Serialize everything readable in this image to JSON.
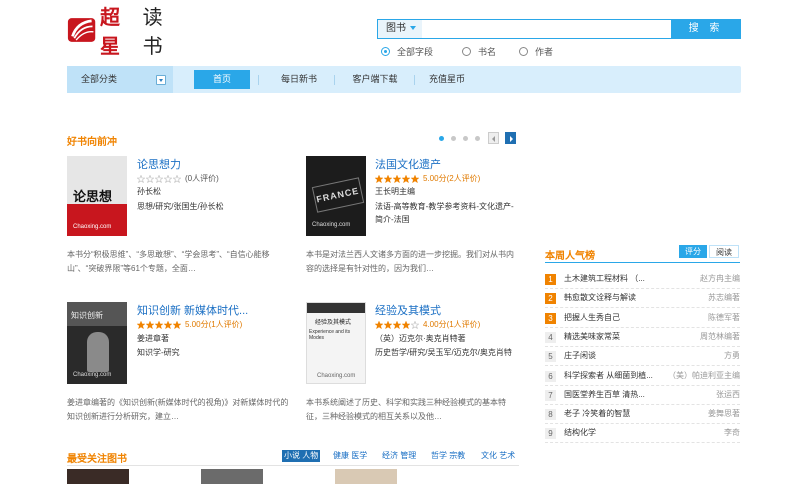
{
  "header": {
    "logo_text": "超星",
    "site_name": "读书",
    "search": {
      "category": "图书",
      "placeholder": "",
      "button": "搜 索",
      "options": [
        "全部字段",
        "书名",
        "作者"
      ]
    }
  },
  "nav": {
    "all_categories": "全部分类",
    "items": [
      "首页",
      "每日新书",
      "客户端下载",
      "充值星币"
    ]
  },
  "featured": {
    "title": "好书向前冲",
    "books": [
      {
        "title": "论思想力",
        "rating_text": "(0人评价)",
        "stars": 0,
        "author": "孙长松",
        "tags": "思想/研究/张国生/孙长松",
        "description": "本书分“积极思维”、“多思敢想”、“学会思考”、“自信心能移山”、“突破界限”等61个专题，全面…",
        "cover_title": "论思想力",
        "watermark": "Chaoxing.com"
      },
      {
        "title": "法国文化遗产",
        "rating_text": "5.00分(2人评价)",
        "stars": 5,
        "author": "王长明主编",
        "tags": "法语-高等教育-教学参考资料-文化遗产-简介-法国",
        "description": "本书是对法兰西人文诸多方面的进一步挖掘。我们对从书内容的选择是有针对性的，因为我们…",
        "cover_title": "FRANCE",
        "watermark": "Chaoxing.com"
      },
      {
        "title": "知识创新 新媒体时代...",
        "rating_text": "5.00分(1人评价)",
        "stars": 5,
        "author": "姜进章著",
        "tags": "知识学-研究",
        "description": "姜进章编著的《知识创新(新媒体时代的视角)》对新媒体时代的知识创新进行分析研究，建立…",
        "cover_title": "知识创新",
        "watermark": "Chaoxing.com"
      },
      {
        "title": "经验及其模式",
        "rating_text": "4.00分(1人评价)",
        "stars": 4,
        "author": "（英）迈克尔·奥克肖特著",
        "tags": "历史哲学/研究/吴玉军/迈克尔/奥克肖特",
        "description": "本书系统阐述了历史、科学和实践三种经验模式的基本特征，三种经验模式的相互关系以及他…",
        "cover_title": "经验及其模式",
        "cover_sub": "Experience and its Modes",
        "watermark": "Chaoxing.com"
      }
    ]
  },
  "ranking": {
    "title": "本周人气榜",
    "tabs": [
      "评分",
      "阅读"
    ],
    "items": [
      {
        "no": "1",
        "title": "土木建筑工程材料 （...",
        "author": "赵方冉主编"
      },
      {
        "no": "2",
        "title": "韩愈散文诠释与解读",
        "author": "苏志编著"
      },
      {
        "no": "3",
        "title": "把握人生秀自己",
        "author": "陈德军著"
      },
      {
        "no": "4",
        "title": "精选美味家常菜",
        "author": "周范林编著"
      },
      {
        "no": "5",
        "title": "庄子闲谈",
        "author": "方勇"
      },
      {
        "no": "6",
        "title": "科学探索者 从细菌到植...",
        "author": "（美）帕迪利亚主编"
      },
      {
        "no": "7",
        "title": "国医堂养生百草 清热...",
        "author": "张运西"
      },
      {
        "no": "8",
        "title": "老子 冷笑着的智慧",
        "author": "姜舞思著"
      },
      {
        "no": "9",
        "title": "结构化学",
        "author": "李奇"
      }
    ]
  },
  "popular": {
    "title": "最受关注图书",
    "tabs": [
      "小说 人物",
      "健康 医学",
      "经济 管理",
      "哲学 宗教",
      "文化 艺术"
    ]
  },
  "colors": {
    "accent": "#2aa7e8",
    "brand": "#c8161e",
    "section_title": "#f08300",
    "link": "#1a6fc4",
    "nav_bg": "#d8eefc"
  },
  "icons": {
    "logo": "ox-logo-icon",
    "star": "star-icon",
    "dropdown": "chevron-down-icon"
  }
}
